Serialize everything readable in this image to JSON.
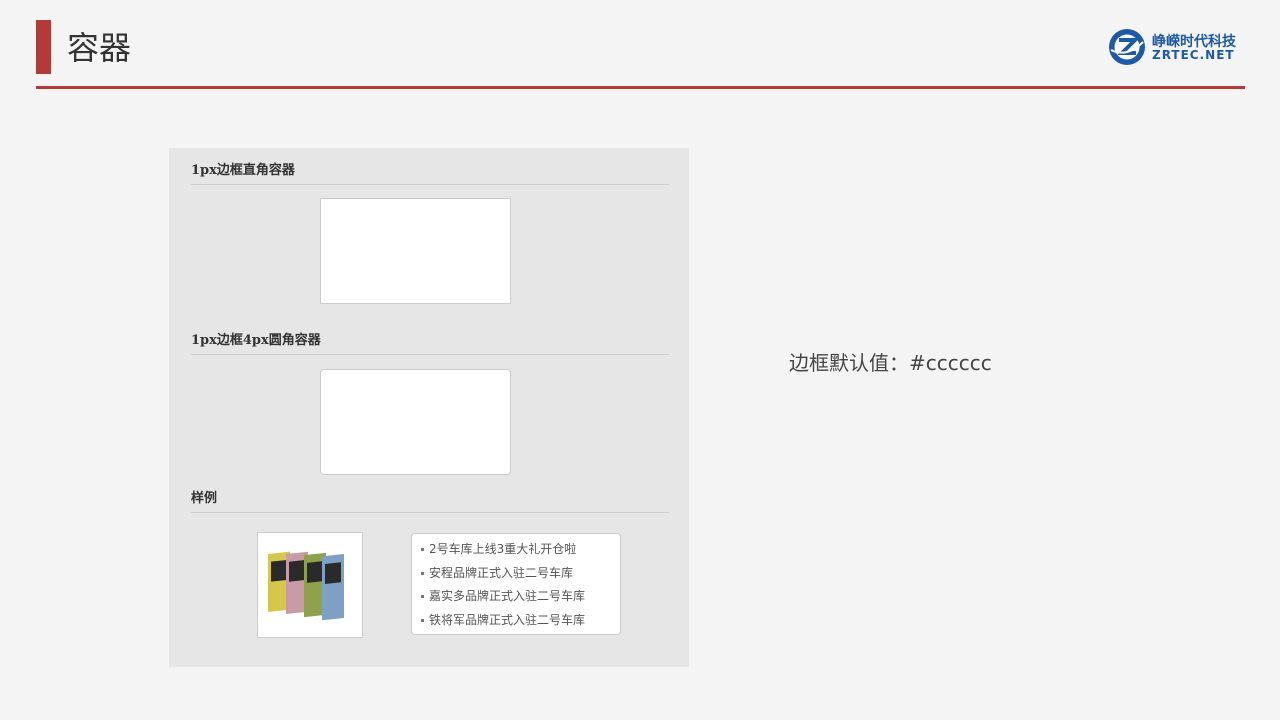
{
  "slide": {
    "title": "容器"
  },
  "logo": {
    "cn": "峥嵘时代科技",
    "en": "ZRTEC.NET"
  },
  "demo": {
    "section1": "1px边框直角容器",
    "section2": "1px边框4px圆角容器",
    "section3": "样例",
    "list": [
      "2号车库上线3重大礼开仓啦",
      "安程品牌正式入驻二号车库",
      "嘉实多品牌正式入驻二号车库",
      "铁将军品牌正式入驻二号车库"
    ]
  },
  "note": "边框默认值：#cccccc",
  "colors": {
    "accent": "#b23b3a",
    "border_default": "#cccccc",
    "logo_blue": "#1f5aa8"
  }
}
